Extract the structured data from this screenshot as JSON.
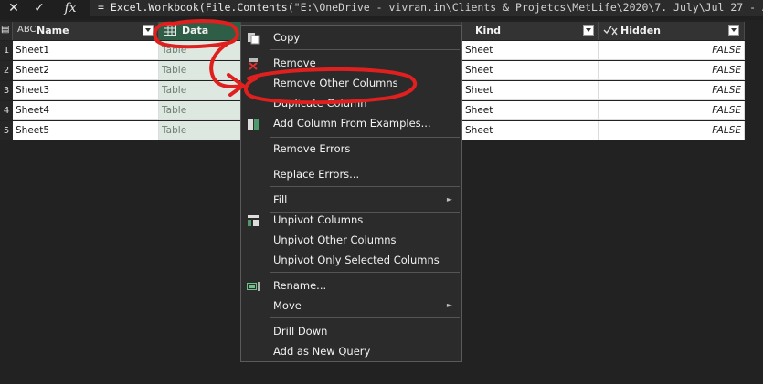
{
  "formula_bar": {
    "cancel_glyph": "✕",
    "confirm_glyph": "✓",
    "fx_label": "fx",
    "formula_prefix": "= Excel.Workbook(File.Contents(",
    "formula_path": "\"E:\\OneDrive - vivran.in\\Clients & Projetcs\\MetLife\\2020\\7. July\\Jul 27 - Aug 4"
  },
  "columns": [
    {
      "type_icon": "ABC",
      "name": "Name"
    },
    {
      "type_icon": "table-icon",
      "name": "Data"
    },
    {
      "type_icon": "",
      "name": ""
    },
    {
      "type_icon": "ABC",
      "name": "Kind"
    },
    {
      "type_icon": "check-x",
      "name": "Hidden"
    }
  ],
  "rows": [
    {
      "n": "1",
      "name": "Sheet1",
      "data": "Table",
      "kind": "Sheet",
      "hidden": "FALSE"
    },
    {
      "n": "2",
      "name": "Sheet2",
      "data": "Table",
      "kind": "Sheet",
      "hidden": "FALSE"
    },
    {
      "n": "3",
      "name": "Sheet3",
      "data": "Table",
      "kind": "Sheet",
      "hidden": "FALSE"
    },
    {
      "n": "4",
      "name": "Sheet4",
      "data": "Table",
      "kind": "Sheet",
      "hidden": "FALSE"
    },
    {
      "n": "5",
      "name": "Sheet5",
      "data": "Table",
      "kind": "Sheet",
      "hidden": "FALSE"
    }
  ],
  "context_menu": {
    "items": [
      {
        "label": "Copy",
        "icon": "copy-icon"
      },
      {
        "label": "Remove",
        "icon": "remove-icon"
      },
      {
        "label": "Remove Other Columns",
        "icon": ""
      },
      {
        "label": "Duplicate Column",
        "icon": ""
      },
      {
        "label": "Add Column From Examples...",
        "icon": "examples-icon"
      },
      {
        "label": "Remove Errors",
        "icon": ""
      },
      {
        "label": "Replace Errors...",
        "icon": ""
      },
      {
        "label": "Fill",
        "icon": "",
        "submenu": "►"
      },
      {
        "label": "Unpivot Columns",
        "icon": "unpivot-icon"
      },
      {
        "label": "Unpivot Other Columns",
        "icon": ""
      },
      {
        "label": "Unpivot Only Selected Columns",
        "icon": ""
      },
      {
        "label": "Rename...",
        "icon": "rename-icon"
      },
      {
        "label": "Move",
        "icon": "",
        "submenu": "►"
      },
      {
        "label": "Drill Down",
        "icon": ""
      },
      {
        "label": "Add as New Query",
        "icon": ""
      }
    ]
  },
  "colors": {
    "annotation": "#e0201e",
    "selected_column": "#dde8e0",
    "menu_bg": "#2b2b2b"
  }
}
